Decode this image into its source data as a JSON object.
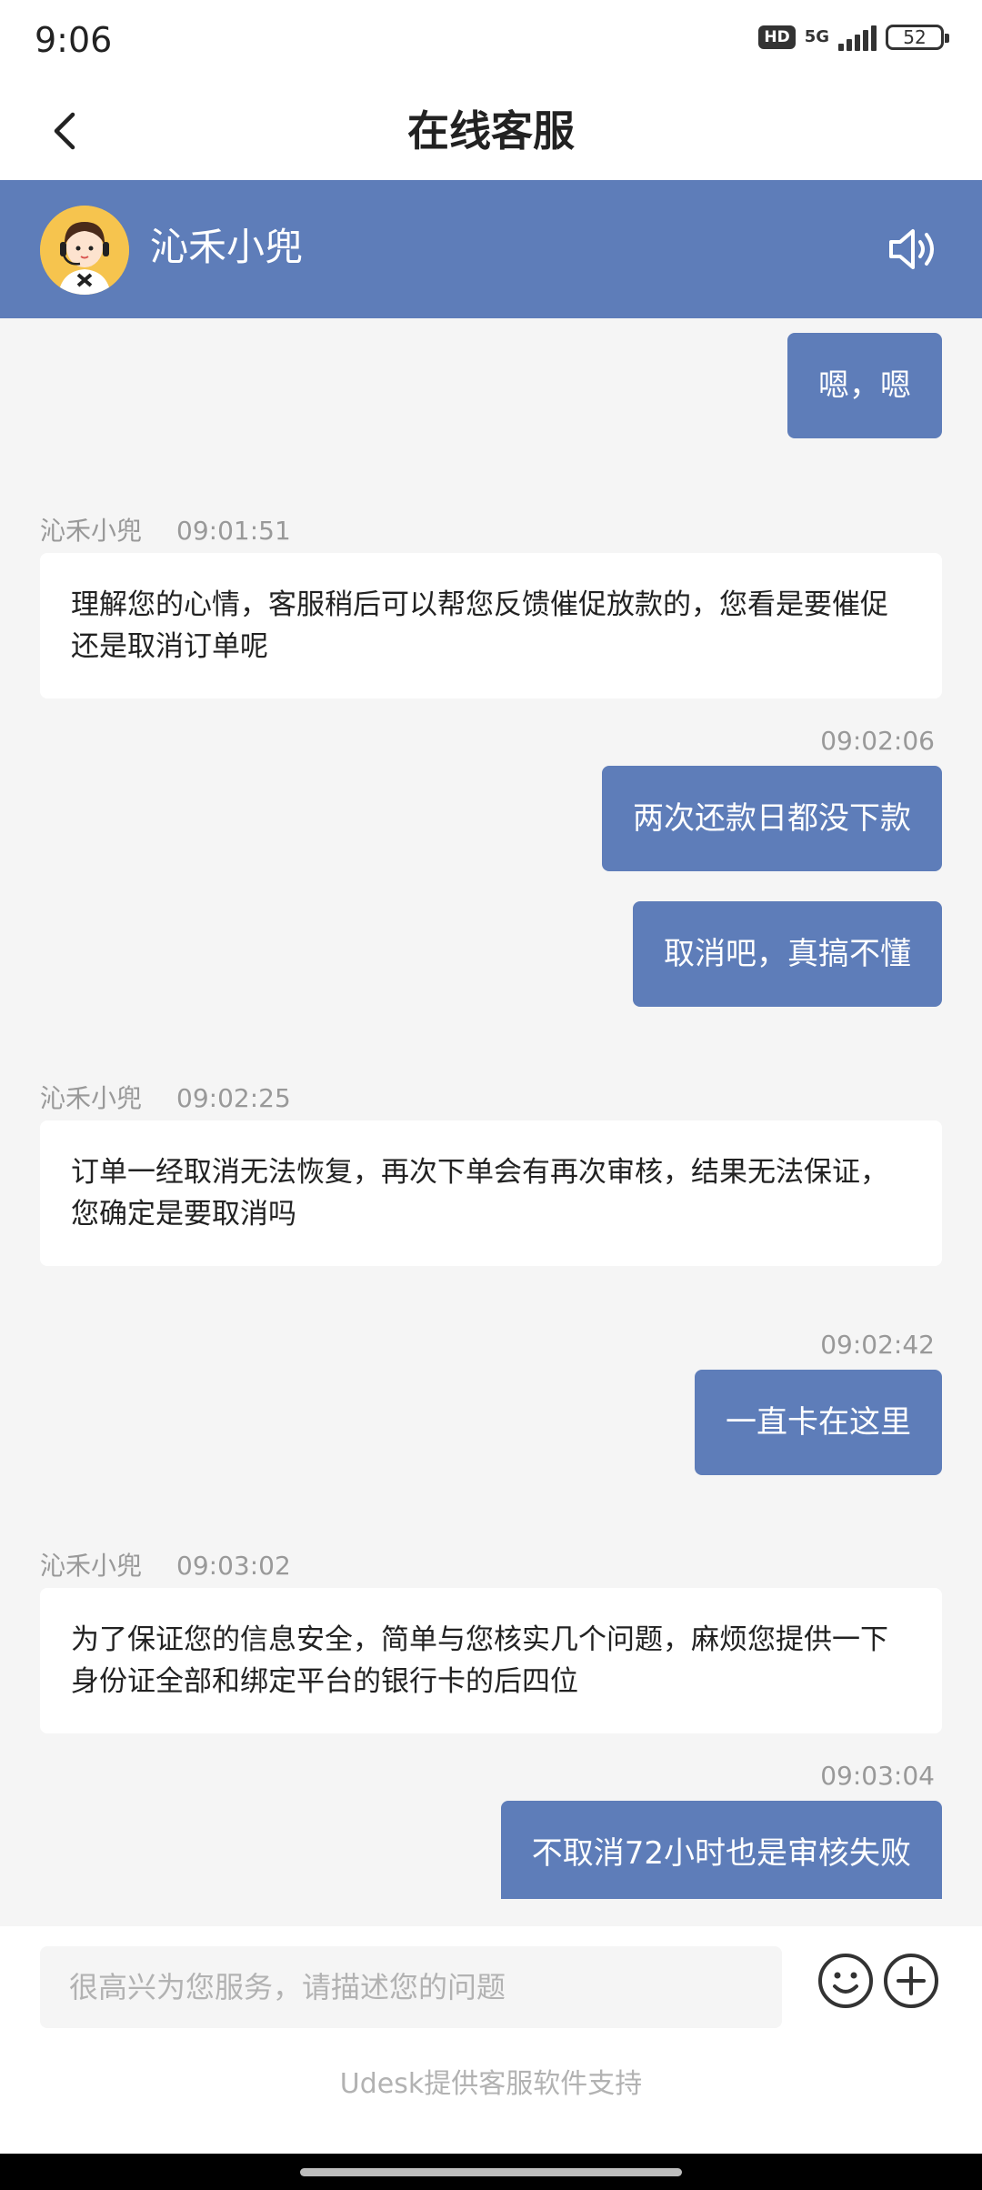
{
  "status_bar": {
    "time": "9:06",
    "hd": "HD",
    "network": "5G",
    "battery": "52"
  },
  "nav": {
    "title": "在线客服"
  },
  "agent": {
    "name": "沁禾小兜"
  },
  "messages": [
    {
      "side": "right",
      "text": "嗯，嗯"
    },
    {
      "side": "left",
      "sender": "沁禾小兜",
      "time": "09:01:51",
      "text": "理解您的心情，客服稍后可以帮您反馈催促放款的，您看是要催促还是取消订单呢"
    },
    {
      "side": "right",
      "time": "09:02:06",
      "text": "两次还款日都没下款"
    },
    {
      "side": "right",
      "text": "取消吧，真搞不懂"
    },
    {
      "side": "left",
      "sender": "沁禾小兜",
      "time": "09:02:25",
      "text": "订单一经取消无法恢复，再次下单会有再次审核，结果无法保证，您确定是要取消吗"
    },
    {
      "side": "right",
      "time": "09:02:42",
      "text": "一直卡在这里"
    },
    {
      "side": "left",
      "sender": "沁禾小兜",
      "time": "09:03:02",
      "text": "为了保证您的信息安全，简单与您核实几个问题，麻烦您提供一下身份证全部和绑定平台的银行卡的后四位"
    },
    {
      "side": "right",
      "time": "09:03:04",
      "text": "不取消72小时也是审核失败"
    }
  ],
  "input": {
    "placeholder": "很高兴为您服务，请描述您的问题"
  },
  "footer": {
    "powered_by": "Udesk提供客服软件支持"
  },
  "colors": {
    "brand": "#5e7db9",
    "background": "#f5f5f5"
  }
}
